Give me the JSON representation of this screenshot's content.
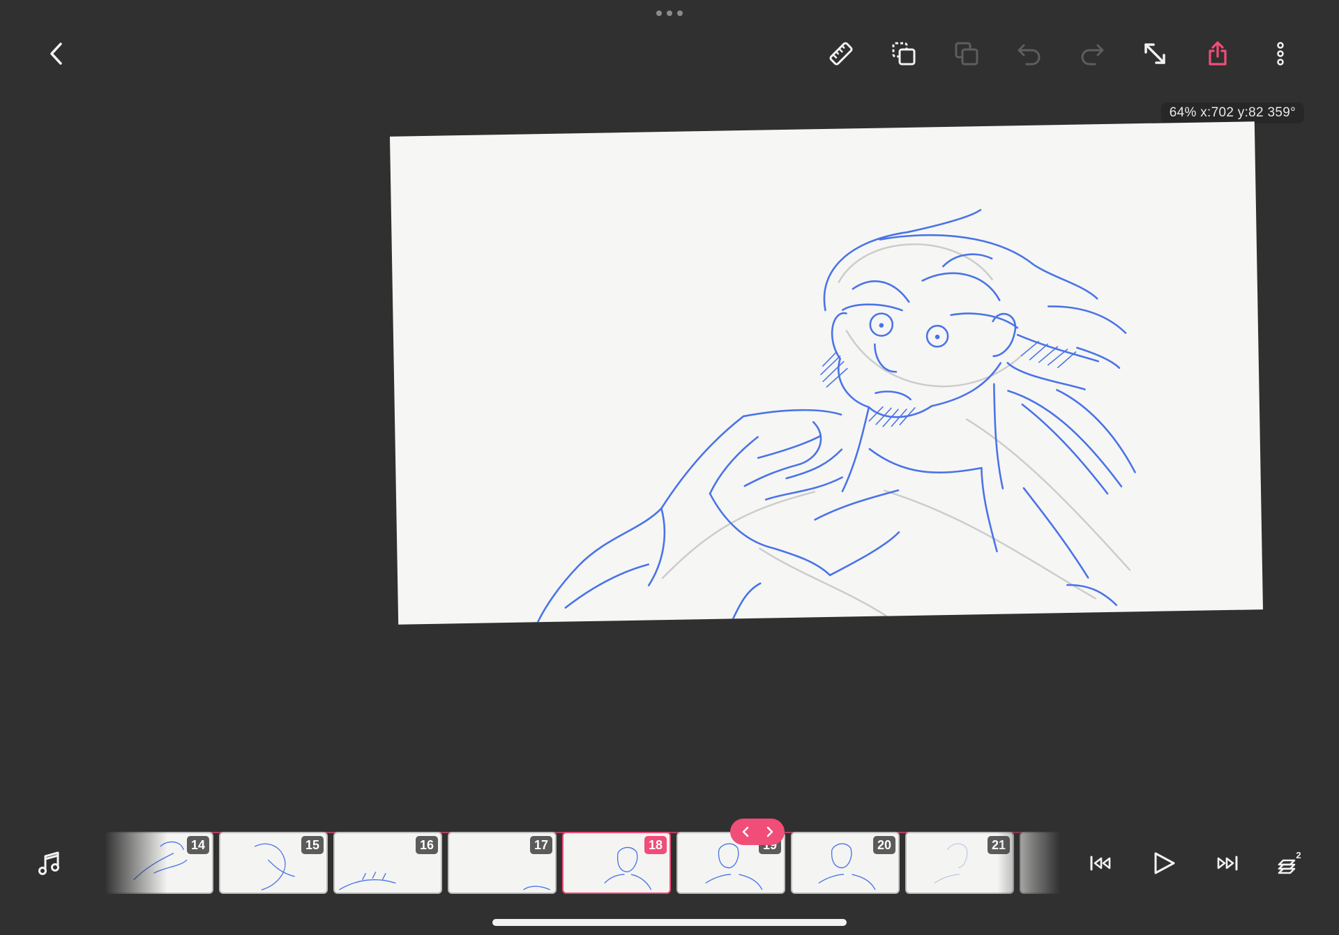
{
  "toolbar": {
    "back_icon": "chevron-left-icon",
    "ruler_icon": "ruler-icon",
    "duplicate_icon": "duplicate-frame-icon",
    "copy_icon": "copy-icon",
    "undo_icon": "undo-icon",
    "redo_icon": "redo-icon",
    "resize_icon": "resize-arrows-icon",
    "share_icon": "share-icon",
    "more_icon": "more-vertical-icon"
  },
  "status": {
    "readout": "64% x:702 y:82 359°"
  },
  "timeline": {
    "frames": [
      {
        "number": "14"
      },
      {
        "number": "15"
      },
      {
        "number": "16"
      },
      {
        "number": "17"
      },
      {
        "number": "18"
      },
      {
        "number": "19"
      },
      {
        "number": "20"
      },
      {
        "number": "21"
      }
    ],
    "current_frame": "18"
  },
  "playback": {
    "music_icon": "music-note-icon",
    "first_icon": "skip-to-start-icon",
    "play_icon": "play-icon",
    "last_icon": "skip-to-end-icon",
    "layers_icon": "layers-icon",
    "layers_count": "2"
  },
  "colors": {
    "background": "#303030",
    "accent": "#f04d78",
    "sketch_blue": "#4a73e8",
    "paper": "#f6f6f4"
  }
}
